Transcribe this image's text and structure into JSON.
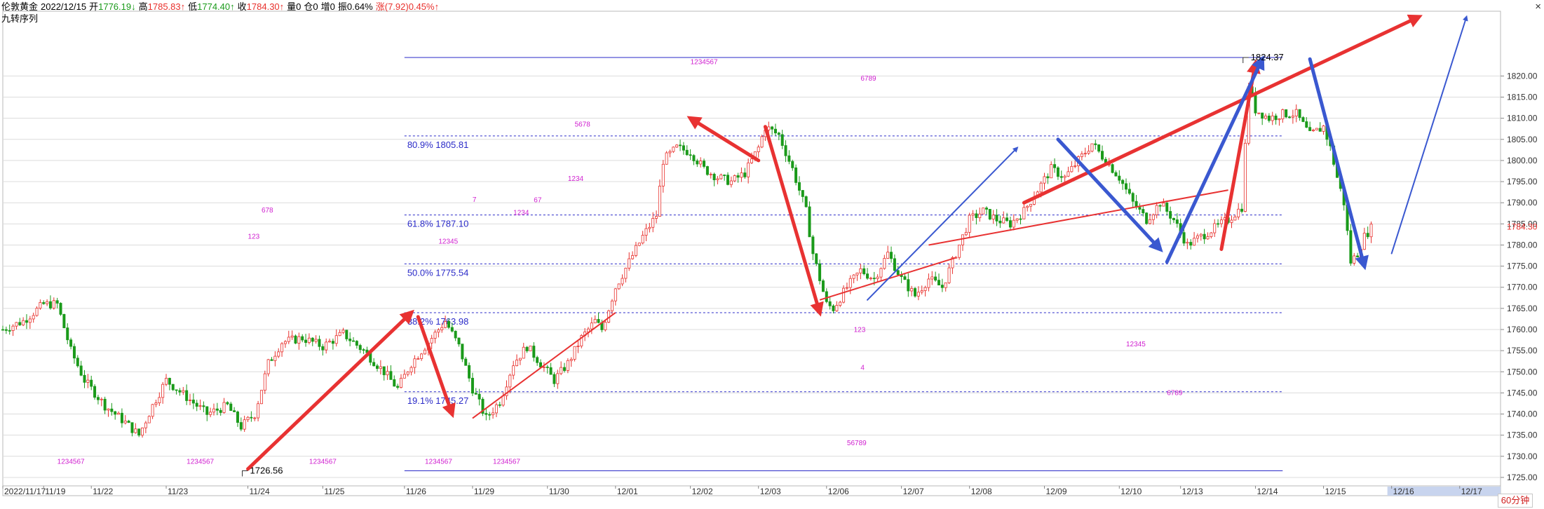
{
  "header": {
    "symbol": "伦敦黄金",
    "date": "2022/12/15",
    "open_label": "开",
    "open": "1776.19",
    "high_label": "高",
    "high": "1785.83",
    "low_label": "低",
    "low": "1774.40",
    "close_label": "收",
    "close": "1784.30",
    "volume": "量0",
    "position": "仓0",
    "increase": "增0",
    "amplitude": "振0.64%",
    "change": "涨(7.92)0.45%",
    "indicator": "九转序列"
  },
  "period_tab": "60分钟",
  "colors": {
    "up": "#e8302c",
    "down": "#1a9a1a",
    "fib_line": "#2a2ac8",
    "arrow_red": "#e83232",
    "arrow_blue": "#3a58d0",
    "seq": "#d020d0",
    "axis_text": "#303030"
  },
  "chart_data": {
    "type": "candlestick",
    "ylim": [
      1723,
      1834
    ],
    "y_ticks": [
      "1725.00",
      "1730.00",
      "1735.00",
      "1740.00",
      "1745.00",
      "1750.00",
      "1755.00",
      "1760.00",
      "1765.00",
      "1770.00",
      "1775.00",
      "1780.00",
      "1785.00",
      "1790.00",
      "1795.00",
      "1800.00",
      "1805.00",
      "1810.00",
      "1815.00",
      "1820.00"
    ],
    "last_price_label": "1784.30",
    "x_labels": [
      {
        "label": "2022/11/17",
        "t": 0
      },
      {
        "label": "11/19",
        "t": 6
      },
      {
        "label": "11/22",
        "t": 13
      },
      {
        "label": "11/23",
        "t": 24
      },
      {
        "label": "11/24",
        "t": 36
      },
      {
        "label": "11/25",
        "t": 47
      },
      {
        "label": "11/26",
        "t": 59
      },
      {
        "label": "11/29",
        "t": 69
      },
      {
        "label": "11/30",
        "t": 80
      },
      {
        "label": "12/01",
        "t": 90
      },
      {
        "label": "12/02",
        "t": 101
      },
      {
        "label": "12/03",
        "t": 111
      },
      {
        "label": "12/06",
        "t": 121
      },
      {
        "label": "12/07",
        "t": 132
      },
      {
        "label": "12/08",
        "t": 142
      },
      {
        "label": "12/09",
        "t": 153
      },
      {
        "label": "12/10",
        "t": 164
      },
      {
        "label": "12/13",
        "t": 173
      },
      {
        "label": "12/14",
        "t": 184
      },
      {
        "label": "12/15",
        "t": 194
      },
      {
        "label": "12/16",
        "t": 204,
        "future": true
      },
      {
        "label": "12/17",
        "t": 214,
        "future": true
      }
    ],
    "price_path": [
      [
        0,
        1760
      ],
      [
        3,
        1762
      ],
      [
        6,
        1766
      ],
      [
        8,
        1766
      ],
      [
        10,
        1755
      ],
      [
        12,
        1748
      ],
      [
        15,
        1742
      ],
      [
        18,
        1738
      ],
      [
        20,
        1735
      ],
      [
        22,
        1742
      ],
      [
        24,
        1748
      ],
      [
        27,
        1744
      ],
      [
        30,
        1740
      ],
      [
        33,
        1742
      ],
      [
        35,
        1737
      ],
      [
        37,
        1740
      ],
      [
        39,
        1752
      ],
      [
        41,
        1757
      ],
      [
        44,
        1758
      ],
      [
        47,
        1756
      ],
      [
        50,
        1759
      ],
      [
        53,
        1755
      ],
      [
        56,
        1750
      ],
      [
        58,
        1746
      ],
      [
        60,
        1752
      ],
      [
        63,
        1758
      ],
      [
        65,
        1762
      ],
      [
        67,
        1756
      ],
      [
        69,
        1746
      ],
      [
        71,
        1739
      ],
      [
        73,
        1743
      ],
      [
        75,
        1752
      ],
      [
        77,
        1756
      ],
      [
        79,
        1752
      ],
      [
        81,
        1748
      ],
      [
        83,
        1752
      ],
      [
        85,
        1758
      ],
      [
        87,
        1762
      ],
      [
        88,
        1760
      ],
      [
        90,
        1770
      ],
      [
        92,
        1776
      ],
      [
        94,
        1782
      ],
      [
        96,
        1787
      ],
      [
        97,
        1800
      ],
      [
        99,
        1803
      ],
      [
        101,
        1802
      ],
      [
        103,
        1798
      ],
      [
        105,
        1796
      ],
      [
        107,
        1795
      ],
      [
        109,
        1797
      ],
      [
        111,
        1803
      ],
      [
        112,
        1808
      ],
      [
        114,
        1806
      ],
      [
        116,
        1798
      ],
      [
        118,
        1788
      ],
      [
        119,
        1778
      ],
      [
        121,
        1766
      ],
      [
        122,
        1765
      ],
      [
        124,
        1770
      ],
      [
        126,
        1774
      ],
      [
        128,
        1772
      ],
      [
        130,
        1778
      ],
      [
        132,
        1772
      ],
      [
        134,
        1768
      ],
      [
        136,
        1772
      ],
      [
        138,
        1770
      ],
      [
        140,
        1778
      ],
      [
        142,
        1786
      ],
      [
        144,
        1788
      ],
      [
        146,
        1786
      ],
      [
        148,
        1785
      ],
      [
        150,
        1788
      ],
      [
        152,
        1793
      ],
      [
        154,
        1798
      ],
      [
        156,
        1796
      ],
      [
        158,
        1800
      ],
      [
        160,
        1804
      ],
      [
        162,
        1800
      ],
      [
        164,
        1796
      ],
      [
        166,
        1790
      ],
      [
        168,
        1786
      ],
      [
        170,
        1790
      ],
      [
        172,
        1786
      ],
      [
        174,
        1780
      ],
      [
        176,
        1782
      ],
      [
        178,
        1784
      ],
      [
        180,
        1786
      ],
      [
        182,
        1789
      ],
      [
        183,
        1818
      ],
      [
        184,
        1812
      ],
      [
        186,
        1810
      ],
      [
        188,
        1811
      ],
      [
        190,
        1811
      ],
      [
        192,
        1806
      ],
      [
        194,
        1808
      ],
      [
        195,
        1803
      ],
      [
        196,
        1796
      ],
      [
        197,
        1790
      ],
      [
        198,
        1776
      ],
      [
        199,
        1778
      ],
      [
        200,
        1782
      ],
      [
        201,
        1784
      ]
    ],
    "fib_levels": [
      {
        "label": "80.9% 1805.81",
        "value": 1805.81
      },
      {
        "label": "61.8% 1787.10",
        "value": 1787.1
      },
      {
        "label": "50.0% 1775.54",
        "value": 1775.54
      },
      {
        "label": "38.2% 1763.98",
        "value": 1763.98
      },
      {
        "label": "19.1% 1745.27",
        "value": 1745.27
      }
    ],
    "range_lines": [
      1824.37,
      1726.56
    ],
    "annotations": [
      {
        "text": "1824.37",
        "t": 183,
        "value": 1824.37
      },
      {
        "text": "1726.56",
        "t": 36,
        "value": 1726.56
      }
    ],
    "red_arrows": [
      [
        [
          36,
          1727
        ],
        [
          60,
          1764
        ]
      ],
      [
        [
          61,
          1763
        ],
        [
          66,
          1740
        ]
      ],
      [
        [
          111,
          1800
        ],
        [
          101,
          1810
        ]
      ],
      [
        [
          112,
          1808
        ],
        [
          120,
          1764
        ]
      ],
      [
        [
          179,
          1779
        ],
        [
          184,
          1823
        ]
      ],
      [
        [
          150,
          1790
        ],
        [
          208,
          1834
        ]
      ]
    ],
    "red_lines": [
      [
        [
          69,
          1739
        ],
        [
          90,
          1764
        ]
      ],
      [
        [
          120,
          1767
        ],
        [
          140,
          1777
        ]
      ],
      [
        [
          136,
          1780
        ],
        [
          180,
          1793
        ]
      ]
    ],
    "blue_arrows": [
      [
        [
          127,
          1767
        ],
        [
          149,
          1803
        ]
      ],
      [
        [
          155,
          1805
        ],
        [
          170,
          1779
        ]
      ],
      [
        [
          171,
          1776
        ],
        [
          185,
          1824
        ]
      ],
      [
        [
          192,
          1824
        ],
        [
          200,
          1775
        ]
      ],
      [
        [
          204,
          1778
        ],
        [
          215,
          1834
        ]
      ]
    ],
    "seq_labels": [
      {
        "text": "1234567",
        "t": 8,
        "value": 1728.2
      },
      {
        "text": "1234567",
        "t": 27,
        "value": 1728.2
      },
      {
        "text": "1234567",
        "t": 45,
        "value": 1728.2
      },
      {
        "text": "1234567",
        "t": 62,
        "value": 1728.2
      },
      {
        "text": "1234567",
        "t": 72,
        "value": 1728.2
      },
      {
        "text": "1234567",
        "t": 101,
        "value": 1822.8
      },
      {
        "text": "123",
        "t": 36,
        "value": 1781.5
      },
      {
        "text": "678",
        "t": 38,
        "value": 1787.7
      },
      {
        "text": "12345",
        "t": 64,
        "value": 1780.3
      },
      {
        "text": "7",
        "t": 69,
        "value": 1790.2
      },
      {
        "text": "1234",
        "t": 75,
        "value": 1787.1
      },
      {
        "text": "67",
        "t": 78,
        "value": 1790.1
      },
      {
        "text": "1234",
        "t": 83,
        "value": 1795.2
      },
      {
        "text": "5678",
        "t": 84,
        "value": 1808.0
      },
      {
        "text": "6789",
        "t": 126,
        "value": 1818.9
      },
      {
        "text": "123",
        "t": 125,
        "value": 1759.4
      },
      {
        "text": "4",
        "t": 126,
        "value": 1750.5
      },
      {
        "text": "56789",
        "t": 124,
        "value": 1732.6
      },
      {
        "text": "12345",
        "t": 165,
        "value": 1756.0
      },
      {
        "text": "6789",
        "t": 171,
        "value": 1744.5
      }
    ]
  }
}
